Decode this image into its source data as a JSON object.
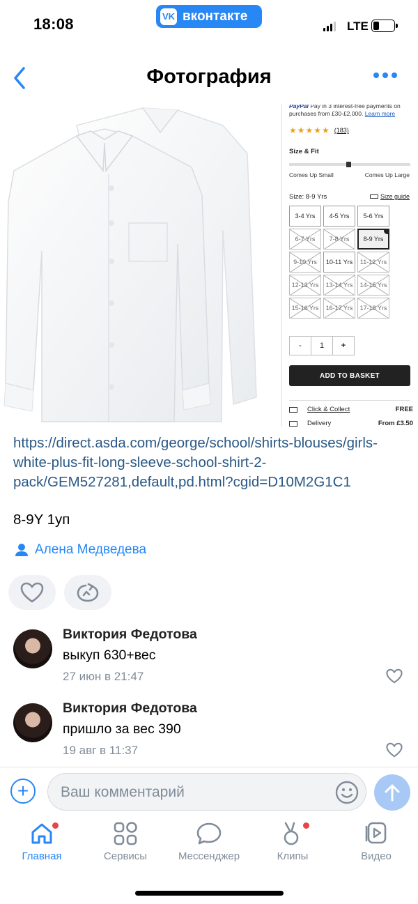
{
  "status_bar": {
    "time": "18:08",
    "app_pill": "вконтакте",
    "network": "LTE"
  },
  "nav": {
    "title": "Фотография"
  },
  "product_panel": {
    "paypal_text": "Pay in 3 interest-free payments on purchases from £30-£2,000.",
    "learn_more": "Learn more",
    "reviews_count": "(183)",
    "rating_stars": 4.5,
    "fit_title": "Size & Fit",
    "fit_small": "Comes Up Small",
    "fit_large": "Comes Up Large",
    "size_label": "Size: 8-9 Yrs",
    "size_guide": "Size guide",
    "sizes": [
      {
        "label": "3-4 Yrs",
        "state": "available"
      },
      {
        "label": "4-5 Yrs",
        "state": "available"
      },
      {
        "label": "5-6 Yrs",
        "state": "available"
      },
      {
        "label": "6-7 Yrs",
        "state": "unavailable"
      },
      {
        "label": "7-8 Yrs",
        "state": "unavailable"
      },
      {
        "label": "8-9 Yrs",
        "state": "selected"
      },
      {
        "label": "9-10 Yrs",
        "state": "unavailable"
      },
      {
        "label": "10-11 Yrs",
        "state": "available"
      },
      {
        "label": "11-12 Yrs",
        "state": "unavailable"
      },
      {
        "label": "12-13 Yrs",
        "state": "unavailable"
      },
      {
        "label": "13-14 Yrs",
        "state": "unavailable"
      },
      {
        "label": "14-15 Yrs",
        "state": "unavailable"
      },
      {
        "label": "15-16 Yrs",
        "state": "unavailable"
      },
      {
        "label": "16-17 Yrs",
        "state": "unavailable"
      },
      {
        "label": "17-18 Yrs",
        "state": "unavailable"
      }
    ],
    "qty_minus": "-",
    "qty_value": "1",
    "qty_plus": "+",
    "add_to_basket": "ADD TO BASKET",
    "click_collect": "Click & Collect",
    "click_collect_price": "FREE",
    "delivery": "Delivery",
    "delivery_price": "From £3.50"
  },
  "post": {
    "link": "https://direct.asda.com/george/school/shirts-blouses/girls-white-plus-fit-long-sleeve-school-shirt-2-pack/GEM527281,default,pd.html?cgid=D10M2G1C1",
    "note": "8-9Y 1уп",
    "author": "Алена Медведева"
  },
  "comments": [
    {
      "author": "Виктория Федотова",
      "text": "выкуп 630+вес",
      "date": "27 июн в 21:47"
    },
    {
      "author": "Виктория Федотова",
      "text": "пришло за вес 390",
      "date": "19 авг в 11:37"
    }
  ],
  "comment_input": {
    "placeholder": "Ваш комментарий"
  },
  "tabbar": [
    {
      "label": "Главная",
      "active": true
    },
    {
      "label": "Сервисы"
    },
    {
      "label": "Мессенджер"
    },
    {
      "label": "Клипы"
    },
    {
      "label": "Видео"
    }
  ],
  "colors": {
    "accent": "#2787f5",
    "link": "#2a5885",
    "muted": "#818c99",
    "badge": "#e64646"
  }
}
